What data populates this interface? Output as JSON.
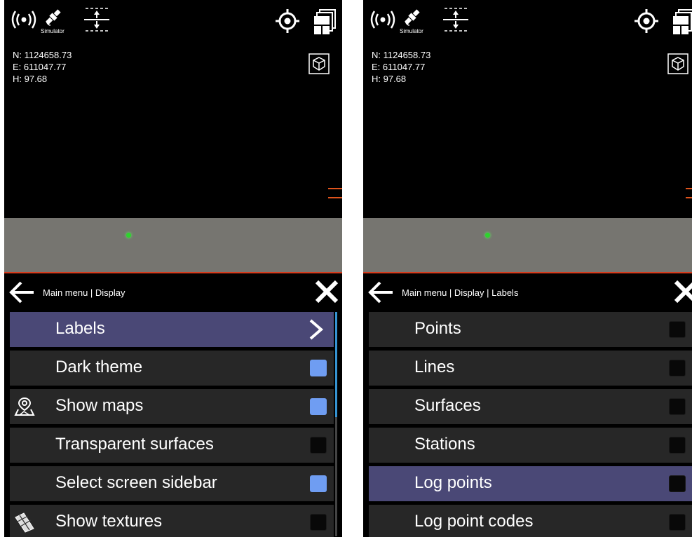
{
  "status": {
    "simulator_label": "Simulator"
  },
  "coords": {
    "north": "N: 1124658.73",
    "east": "E: 611047.77",
    "height": "H: 97.68"
  },
  "colors": {
    "selected_row": "#4a4876",
    "row": "#272727",
    "checkbox_on": "#6f9df2",
    "horizon_line": "#d73b1c",
    "ground": "#767570"
  },
  "left_panel": {
    "breadcrumb": "Main menu | Display",
    "items": [
      {
        "label": "Labels",
        "control": "chevron",
        "selected": true
      },
      {
        "label": "Dark theme",
        "control": "checkbox",
        "checked": true
      },
      {
        "label": "Show maps",
        "control": "checkbox",
        "checked": true,
        "icon": "map-pin-icon"
      },
      {
        "label": "Transparent surfaces",
        "control": "checkbox",
        "checked": false
      },
      {
        "label": "Select screen sidebar",
        "control": "checkbox",
        "checked": true
      },
      {
        "label": "Show textures",
        "control": "checkbox",
        "checked": false,
        "icon": "texture-mesh-icon"
      }
    ]
  },
  "right_panel": {
    "breadcrumb": "Main menu | Display | Labels",
    "items": [
      {
        "label": "Points",
        "control": "checkbox",
        "checked": false
      },
      {
        "label": "Lines",
        "control": "checkbox",
        "checked": false
      },
      {
        "label": "Surfaces",
        "control": "checkbox",
        "checked": false
      },
      {
        "label": "Stations",
        "control": "checkbox",
        "checked": false
      },
      {
        "label": "Log points",
        "control": "checkbox",
        "checked": false,
        "selected": true
      },
      {
        "label": "Log point codes",
        "control": "checkbox",
        "checked": false
      }
    ]
  }
}
